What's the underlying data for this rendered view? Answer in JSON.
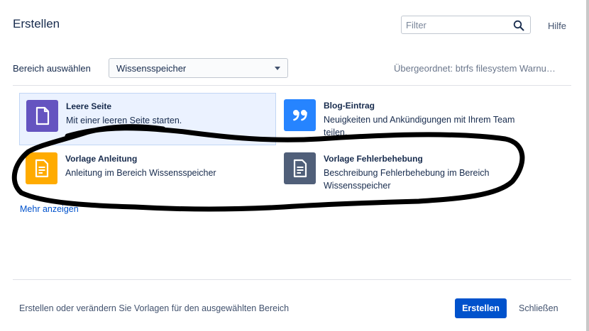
{
  "dialog": {
    "title": "Erstellen",
    "filter_placeholder": "Filter",
    "help_label": "Hilfe"
  },
  "space": {
    "label": "Bereich auswählen",
    "selected": "Wissensspeicher",
    "parent": "Übergeordnet: btrfs filesystem Warnu…"
  },
  "templates": [
    {
      "name": "Leere Seite",
      "description": "Mit einer leeren Seite starten.",
      "icon": "blank-page-icon",
      "color": "#6554c0"
    },
    {
      "name": "Blog-Eintrag",
      "description": "Neuigkeiten und Ankündigungen mit Ihrem Team teilen.",
      "icon": "quote-icon",
      "color": "#2684ff"
    },
    {
      "name": "Vorlage Anleitung",
      "description": "Anleitung im Bereich Wissensspeicher",
      "icon": "document-icon",
      "color": "#ffab00"
    },
    {
      "name": "Vorlage Fehlerbehebung",
      "description": "Beschreibung Fehlerbehebung im Bereich Wissensspeicher",
      "icon": "document-icon",
      "color": "#505f79"
    }
  ],
  "more_link": "Mehr anzeigen",
  "footer": {
    "text": "Erstellen oder verändern Sie Vorlagen für den ausgewählten Bereich",
    "create_label": "Erstellen",
    "close_label": "Schließen"
  }
}
